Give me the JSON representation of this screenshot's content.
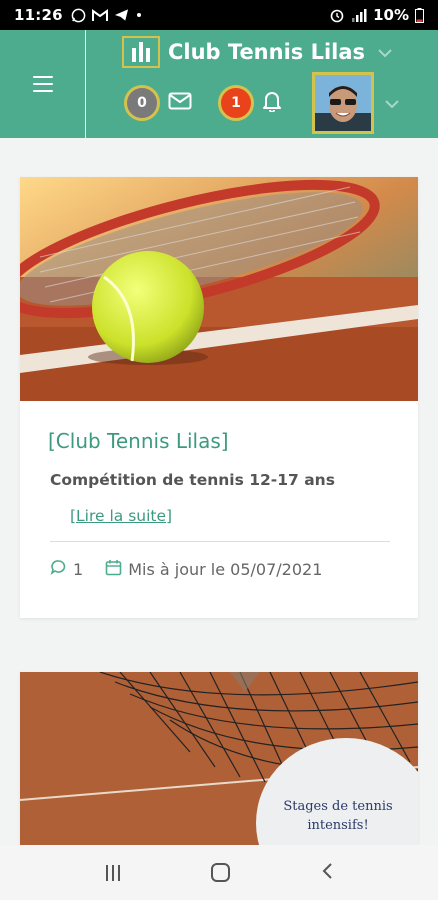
{
  "status_bar": {
    "time": "11:26",
    "battery": "10%",
    "left_icons": [
      "whatsapp-icon",
      "gmail-icon",
      "telegram-icon",
      "dot-icon"
    ],
    "right_icons": [
      "alarm-icon",
      "signal-icon",
      "battery-icon"
    ]
  },
  "header": {
    "club_name": "Club Tennis Lilas",
    "messages_count": "0",
    "notifications_count": "1",
    "colors": {
      "brand_green": "#4dab8e",
      "accent_gold": "#d4c24e",
      "alert_red": "#e8431a"
    }
  },
  "posts": [
    {
      "title": "[Club Tennis Lilas]",
      "excerpt": "Compétition de tennis 12-17 ans",
      "read_more": "[Lire la suite]",
      "comments": "1",
      "updated": "Mis à jour le 05/07/2021"
    },
    {
      "overlay_text_line1": "Stages de tennis",
      "overlay_text_line2": "intensifs!"
    }
  ],
  "nav": {
    "icons": [
      "recent-apps-icon",
      "home-icon",
      "back-icon"
    ]
  }
}
